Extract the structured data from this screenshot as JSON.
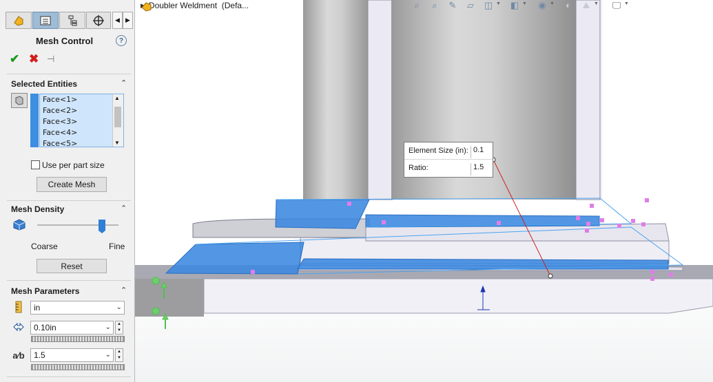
{
  "panel": {
    "tabs": [
      {
        "icon": "feature-manager-icon"
      },
      {
        "icon": "property-manager-icon"
      },
      {
        "icon": "configuration-manager-icon"
      },
      {
        "icon": "dimxpert-icon"
      }
    ],
    "title": "Mesh Control",
    "help_icon": "?",
    "selected_entities": {
      "heading": "Selected Entities",
      "items": [
        "Face<1>",
        "Face<2>",
        "Face<3>",
        "Face<4>",
        "Face<5>"
      ]
    },
    "use_per_part_size": {
      "label": "Use per part size",
      "checked": false
    },
    "create_mesh_label": "Create Mesh",
    "mesh_density": {
      "heading": "Mesh Density",
      "coarse_label": "Coarse",
      "fine_label": "Fine",
      "slider_level_fraction": 0.8,
      "reset_label": "Reset"
    },
    "mesh_parameters": {
      "heading": "Mesh Parameters",
      "unit_value": "in",
      "element_size_value": "0.10in",
      "ratio_value": "1.5"
    }
  },
  "viewport": {
    "tree_label": "Doubler Weldment  (Defa...",
    "callout": {
      "element_size_label": "Element Size (in):",
      "element_size_value": "0.1",
      "ratio_label": "Ratio:",
      "ratio_value": "1.5"
    },
    "selection_color": "#3a87e0",
    "mesh_marker_color": "#e07ee8"
  }
}
